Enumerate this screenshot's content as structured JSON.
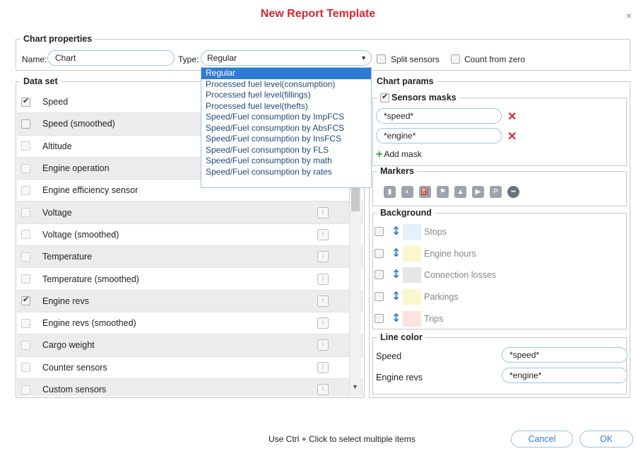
{
  "dialog": {
    "title": "New Report Template",
    "close_symbol": "×"
  },
  "chart_properties": {
    "legend": "Chart properties",
    "name_label": "Name:",
    "name_value": "Chart",
    "type_label": "Type:",
    "type_value": "Regular",
    "split_sensors_label": "Split sensors",
    "count_from_zero_label": "Count from zero",
    "type_options": [
      "Regular",
      "Processed fuel level(consumption)",
      "Processed fuel level(fillings)",
      "Processed fuel level(thefts)",
      "Speed/Fuel consumption by ImpFCS",
      "Speed/Fuel consumption by AbsFCS",
      "Speed/Fuel consumption by InsFCS",
      "Speed/Fuel consumption by FLS",
      "Speed/Fuel consumption by math",
      "Speed/Fuel consumption by rates"
    ]
  },
  "data_set": {
    "legend": "Data set",
    "items": [
      {
        "label": "Speed",
        "checked": true
      },
      {
        "label": "Speed (smoothed)",
        "checked": false
      },
      {
        "label": "Altitude",
        "checked": false
      },
      {
        "label": "Engine operation",
        "checked": false
      },
      {
        "label": "Engine efficiency sensor",
        "checked": false
      },
      {
        "label": "Voltage",
        "checked": false
      },
      {
        "label": "Voltage (smoothed)",
        "checked": false
      },
      {
        "label": "Temperature",
        "checked": false
      },
      {
        "label": "Temperature (smoothed)",
        "checked": false
      },
      {
        "label": "Engine revs",
        "checked": true
      },
      {
        "label": "Engine revs (smoothed)",
        "checked": false
      },
      {
        "label": "Cargo weight",
        "checked": false
      },
      {
        "label": "Counter sensors",
        "checked": false
      },
      {
        "label": "Custom sensors",
        "checked": false
      }
    ]
  },
  "chart_params": {
    "legend": "Chart params",
    "sensors_masks": {
      "legend": "Sensors masks",
      "masks": [
        "*speed*",
        "*engine*"
      ],
      "remove_symbol": "✕",
      "add_label": "Add mask"
    },
    "markers": {
      "legend": "Markers"
    },
    "background": {
      "legend": "Background",
      "items": [
        {
          "label": "Stops",
          "color": "#e3f1fb"
        },
        {
          "label": "Engine hours",
          "color": "#fbf6cc"
        },
        {
          "label": "Connection losses",
          "color": "#e7e7e7"
        },
        {
          "label": "Parkings",
          "color": "#fbf6cc"
        },
        {
          "label": "Trips",
          "color": "#fbe3e0"
        }
      ]
    },
    "line_color": {
      "legend": "Line color",
      "rows": [
        {
          "label": "Speed",
          "value": "*speed*"
        },
        {
          "label": "Engine revs",
          "value": "*engine*"
        }
      ]
    }
  },
  "footer": {
    "hint": "Use Ctrl + Click to select multiple items",
    "cancel_label": "Cancel",
    "ok_label": "OK"
  },
  "colors": {
    "accent": "#2f7bd4",
    "title": "#d4272e",
    "border": "#9ac5e4"
  }
}
